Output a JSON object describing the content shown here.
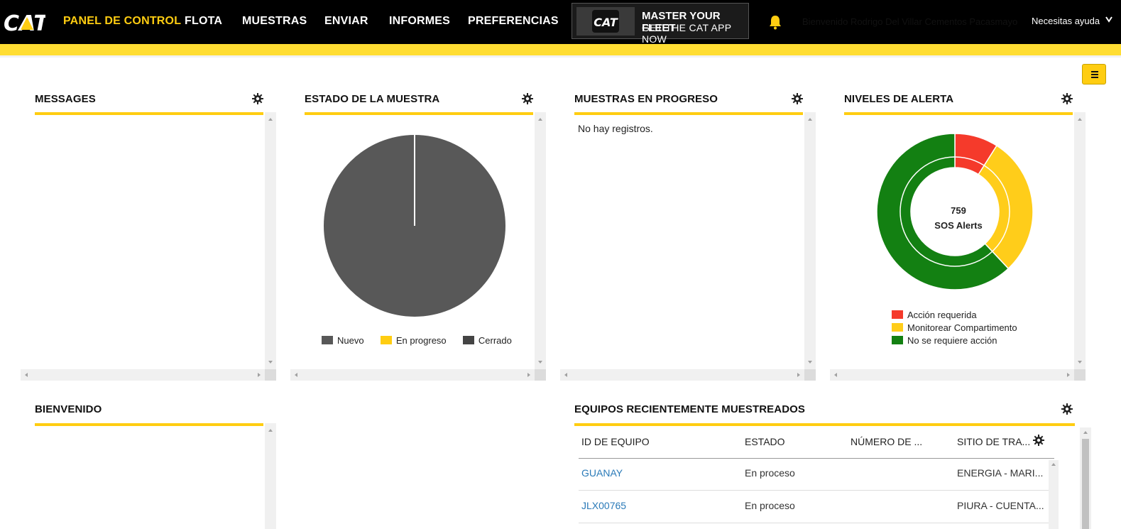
{
  "nav": {
    "items": [
      "PANEL DE CONTROL",
      "FLOTA",
      "MUESTRAS",
      "ENVIAR",
      "INFORMES",
      "PREFERENCIAS"
    ],
    "active_index": 0,
    "logo_text": "CAT",
    "banner": {
      "logo_text": "CAT",
      "line1": "MASTER YOUR FLEET",
      "line2": "GET THE CAT APP NOW"
    },
    "user_text": "Bienvenido Rodrigo Del Villar Cementos Pacasmayo",
    "help": "Necesitas ayuda",
    "brand_yellow": "#ffcd11"
  },
  "widgets": {
    "messages": {
      "title": "MESSAGES"
    },
    "sample_status": {
      "title": "ESTADO DE LA MUESTRA",
      "legend": [
        "Nuevo",
        "En progreso",
        "Cerrado"
      ]
    },
    "in_progress": {
      "title": "MUESTRAS EN PROGRESO",
      "empty_text": "No hay registros."
    },
    "alert_levels": {
      "title": "NIVELES DE ALERTA",
      "center_count": "759",
      "center_label": "SOS Alerts",
      "legend": [
        "Acción requerida",
        "Monitorear Compartimento",
        "No se requiere acción"
      ]
    },
    "welcome": {
      "title": "BIENVENIDO"
    },
    "recent_equipment": {
      "title": "EQUIPOS RECIENTEMENTE MUESTREADOS",
      "columns": [
        "ID DE EQUIPO",
        "ESTADO",
        "NÚMERO DE ...",
        "SITIO DE TRA..."
      ],
      "rows": [
        [
          "GUANAY",
          "En proceso",
          "",
          "ENERGIA - MARI..."
        ],
        [
          "JLX00765",
          "En proceso",
          "",
          "PIURA - CUENTA..."
        ]
      ]
    }
  },
  "chart_data": [
    {
      "type": "pie",
      "categories": [
        "Nuevo",
        "En progreso",
        "Cerrado"
      ],
      "values": [
        1,
        0,
        0
      ],
      "colors": [
        "#585858",
        "#ffcd11",
        "#444444"
      ]
    },
    {
      "type": "pie",
      "categories": [
        "Acción requerida",
        "Monitorear Compartimento",
        "No se requiere acción"
      ],
      "values": [
        0.09,
        0.29,
        0.62
      ],
      "colors": [
        "#f53a2b",
        "#ffcd1a",
        "#138012"
      ]
    }
  ]
}
